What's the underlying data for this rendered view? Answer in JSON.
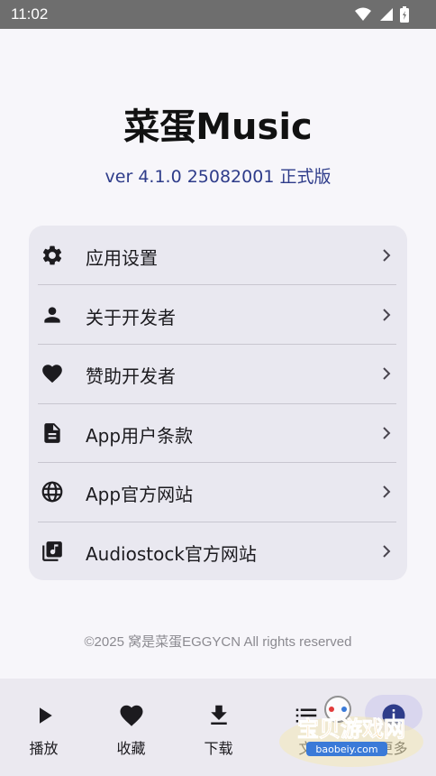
{
  "status_bar": {
    "time": "11:02"
  },
  "app": {
    "title": "菜蛋Music",
    "version": "ver 4.1.0 25082001 正式版"
  },
  "menu": [
    {
      "label": "应用设置",
      "icon": "gear-icon"
    },
    {
      "label": "关于开发者",
      "icon": "person-icon"
    },
    {
      "label": "赞助开发者",
      "icon": "heart-icon"
    },
    {
      "label": "App用户条款",
      "icon": "document-icon"
    },
    {
      "label": "App官方网站",
      "icon": "globe-icon"
    },
    {
      "label": "Audiostock官方网站",
      "icon": "music-library-icon"
    }
  ],
  "copyright": "©2025 窝是菜蛋EGGYCN All rights reserved",
  "bottom_nav": [
    {
      "label": "播放",
      "icon": "play-icon"
    },
    {
      "label": "收藏",
      "icon": "heart-icon"
    },
    {
      "label": "下载",
      "icon": "download-icon"
    },
    {
      "label": "文",
      "icon": "list-icon"
    },
    {
      "label": "更多",
      "icon": "info-icon",
      "active": true
    }
  ],
  "watermark": {
    "brand": "宝贝游戏网",
    "url": "baobeiy.com"
  },
  "colors": {
    "accent": "#2e3c8a",
    "card": "#e9e8f0",
    "nav_active": "#2e3c8a"
  }
}
